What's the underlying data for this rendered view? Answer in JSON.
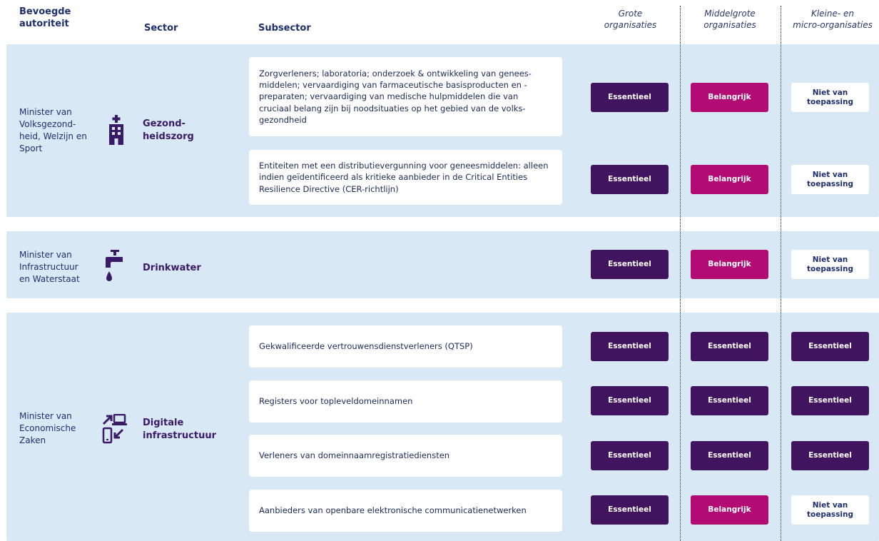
{
  "headers": {
    "authority": "Bevoegde autoriteit",
    "sector": "Sector",
    "subsector": "Subsector",
    "large": "Grote organisaties",
    "medium": "Middelgrote organisaties",
    "small": "Kleine- en micro-organisaties"
  },
  "colors": {
    "block_bg": "#d8e8f4",
    "essentieel": "#40145e",
    "belangrijk": "#b30b74",
    "niet_van_toepassing": "#ffffff"
  },
  "rows": [
    {
      "authority": "Minister van Volksgezond-heid, Welzijn en Sport",
      "sector": "Gezond-heidszorg",
      "icon": "hospital-icon",
      "subsectors": [
        {
          "text": "Zorgverleners; laboratoria; onderzoek & ontwikkeling van genees-middelen; vervaardiging van farmaceutische basisproducten en -preparaten; vervaardiging van medische hulpmiddelen die van cruciaal belang zijn bij noodsituaties op het gebied van de volks-gezondheid",
          "large": "Essentieel",
          "medium": "Belangrijk",
          "small": "Niet van toepassing"
        },
        {
          "text": "Entiteiten met een distributievergunning voor geneesmiddelen: alleen indien geïdentificeerd als kritieke aanbieder in de Critical Entities Resilience Directive (CER-richtlijn)",
          "large": "Essentieel",
          "medium": "Belangrijk",
          "small": "Niet van toepassing"
        }
      ]
    },
    {
      "authority": "Minister van Infrastructuur en Waterstaat",
      "sector": "Drinkwater",
      "icon": "water-tap-icon",
      "large": "Essentieel",
      "medium": "Belangrijk",
      "small": "Niet van toepassing"
    },
    {
      "authority": "Minister van Economische Zaken",
      "sector": "Digitale infrastructuur",
      "icon": "devices-icon",
      "subsectors": [
        {
          "text": "Gekwalificeerde vertrouwensdienstverleners (QTSP)",
          "large": "Essentieel",
          "medium": "Essentieel",
          "small": "Essentieel"
        },
        {
          "text": "Registers voor topleveldomeinnamen",
          "large": "Essentieel",
          "medium": "Essentieel",
          "small": "Essentieel"
        },
        {
          "text": "Verleners van domeinnaamregistratiediensten",
          "large": "Essentieel",
          "medium": "Essentieel",
          "small": "Essentieel"
        },
        {
          "text": "Aanbieders van openbare elektronische communicatienetwerken",
          "large": "Essentieel",
          "medium": "Belangrijk",
          "small": "Niet van toepassing"
        }
      ]
    }
  ]
}
